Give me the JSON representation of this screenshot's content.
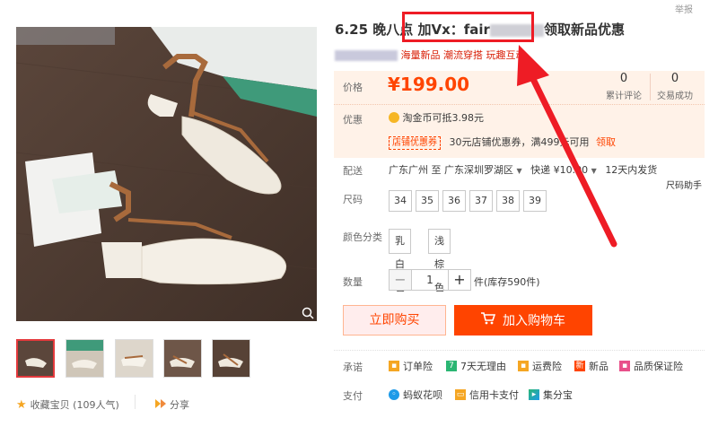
{
  "report_link": "举报",
  "product": {
    "title_before_blur": "6.25 晚八点 加Vx：fair",
    "title_after_blur": "领取新品优惠",
    "subtitle_after_blur": "海量新品 潮流穿搭 玩趣互动",
    "price_label": "价格",
    "price": "¥199.00",
    "review_count": "0",
    "review_label": "累计评论",
    "sales_count": "0",
    "sales_label": "交易成功",
    "promo_label": "优惠",
    "coin_text": "淘金币可抵3.98元",
    "coupon_tag": "店铺优惠券",
    "coupon_text": "30元店铺优惠券，满499元可用",
    "coupon_link": "领取",
    "shipping_label": "配送",
    "shipping_from": "广东广州 至",
    "shipping_to": "广东深圳罗湖区",
    "shipping_fee": "快递 ¥10.00",
    "shipping_time": "12天内发货",
    "size_helper": "尺码助手",
    "size_label": "尺码",
    "sizes": [
      "34",
      "35",
      "36",
      "37",
      "38",
      "39"
    ],
    "color_label": "颜色分类",
    "colors": [
      "乳白色",
      "浅棕色"
    ],
    "qty_label": "数量",
    "qty_minus": "−",
    "qty_value": "1",
    "qty_plus": "+",
    "stock_text": "件(库存590件)",
    "buy_now": "立即购买",
    "add_cart": "加入购物车",
    "promise_label": "承诺",
    "promises": [
      "订单险",
      "7天无理由",
      "运费险",
      "新品",
      "品质保证险"
    ],
    "pay_label": "支付",
    "payments": [
      "蚂蚁花呗",
      "信用卡支付",
      "集分宝"
    ]
  },
  "gallery": {
    "favorite": "收藏宝贝 (109人气)",
    "share": "分享"
  },
  "colors_theme": {
    "accent": "#ff4400",
    "annotation_red": "#ee1c25",
    "price_bg": "#fff2e8"
  }
}
